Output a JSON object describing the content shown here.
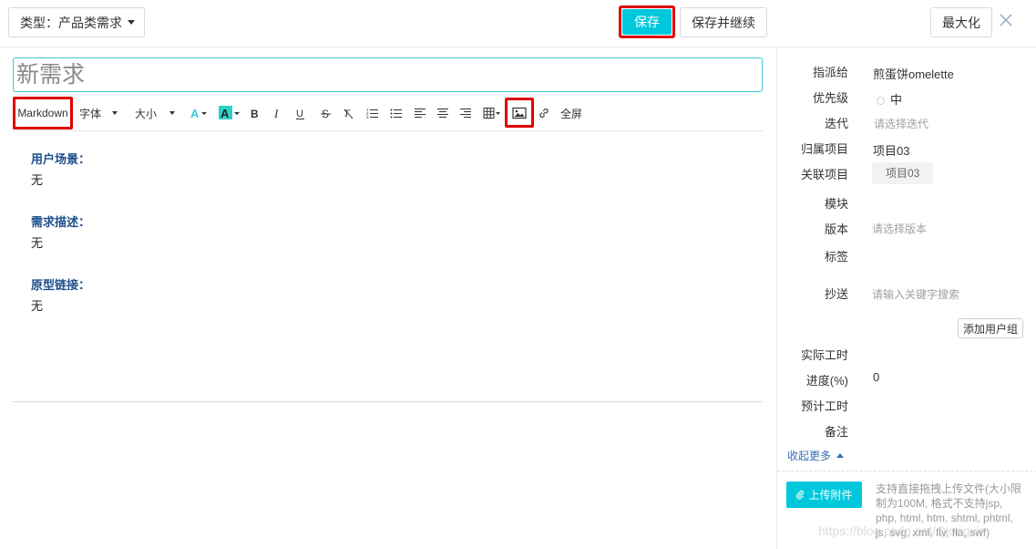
{
  "header": {
    "type_label": "类型：产品类需求",
    "save_label": "保存",
    "save_continue_label": "保存并继续",
    "maximize_label": "最大化",
    "accent_color": "#00c8dc"
  },
  "editor": {
    "title_placeholder": "新需求",
    "toolbar": {
      "markdown_label": "Markdown",
      "font_label": "字体",
      "size_label": "大小",
      "fullscreen_label": "全屏"
    },
    "sections": [
      {
        "title": "用户场景：",
        "body": "无"
      },
      {
        "title": "需求描述：",
        "body": "无"
      },
      {
        "title": "原型链接：",
        "body": "无"
      }
    ]
  },
  "sidebar": {
    "assignee_label": "指派给",
    "assignee_value": "煎蛋饼omelette",
    "priority_label": "优先级",
    "priority_value": "中",
    "iteration_label": "迭代",
    "iteration_placeholder": "请选择迭代",
    "project_label": "归属项目",
    "project_value": "项目03",
    "related_label": "关联项目",
    "related_value": "项目03",
    "module_label": "模块",
    "version_label": "版本",
    "version_placeholder": "请选择版本",
    "tags_label": "标签",
    "cc_label": "抄送",
    "cc_placeholder": "请输入关键字搜索",
    "add_group_label": "添加用户组",
    "actual_hours_label": "实际工时",
    "progress_label": "进度(%)",
    "progress_value": "0",
    "estimated_hours_label": "预计工时",
    "remark_label": "备注",
    "collapse_label": "收起更多",
    "upload_label": "上传附件",
    "upload_hint": "支持直接拖拽上传文件(大小限制为100M, 格式不支持jsp, php, html, htm, shtml, phtml, js, svg, xml, flv, fla, swf)"
  },
  "watermark": "https://blog.csdn.net/Qiongxin"
}
